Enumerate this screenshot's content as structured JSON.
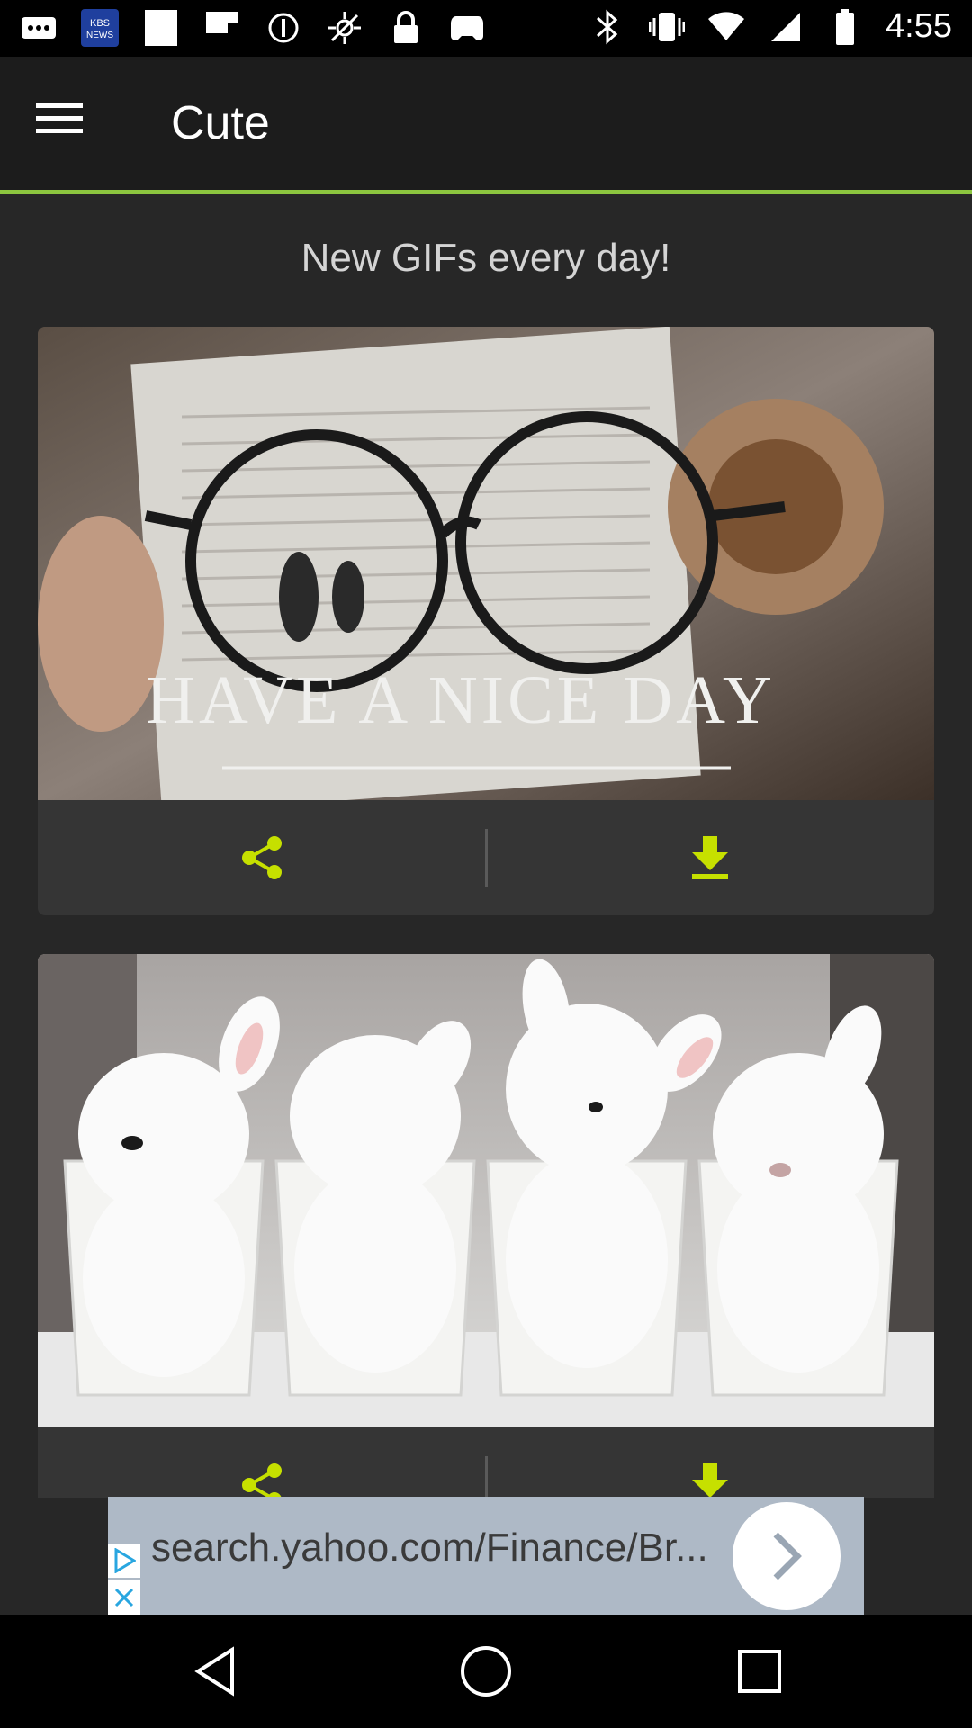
{
  "status_bar": {
    "time": "4:55",
    "left_icons": [
      "more-notifications-icon",
      "kbs-news-icon",
      "blank-note-icon",
      "flipboard-icon",
      "circle-icon",
      "no-gps-icon",
      "lock-icon",
      "game-controller-icon"
    ],
    "right_icons": [
      "bluetooth-icon",
      "vibrate-icon",
      "wifi-icon",
      "signal-icon",
      "battery-icon"
    ]
  },
  "app_bar": {
    "title": "Cute",
    "menu_icon": "hamburger-menu-icon"
  },
  "tagline": "New GIFs every day!",
  "cards": [
    {
      "image_caption": "HAVE A NICE DAY",
      "share_icon": "share-icon",
      "download_icon": "download-icon"
    },
    {
      "image_caption": "",
      "share_icon": "share-icon",
      "download_icon": "download-icon"
    }
  ],
  "ad_banner": {
    "text": "search.yahoo.com/Finance/Br...",
    "arrow_icon": "chevron-right-icon"
  },
  "nav_bar": {
    "icons": [
      "back-icon",
      "home-icon",
      "recents-icon"
    ]
  },
  "colors": {
    "accent": "#8cc63f",
    "icon_yellow_green": "#c6e000",
    "background": "#272727",
    "app_bar": "#1c1c1c"
  }
}
